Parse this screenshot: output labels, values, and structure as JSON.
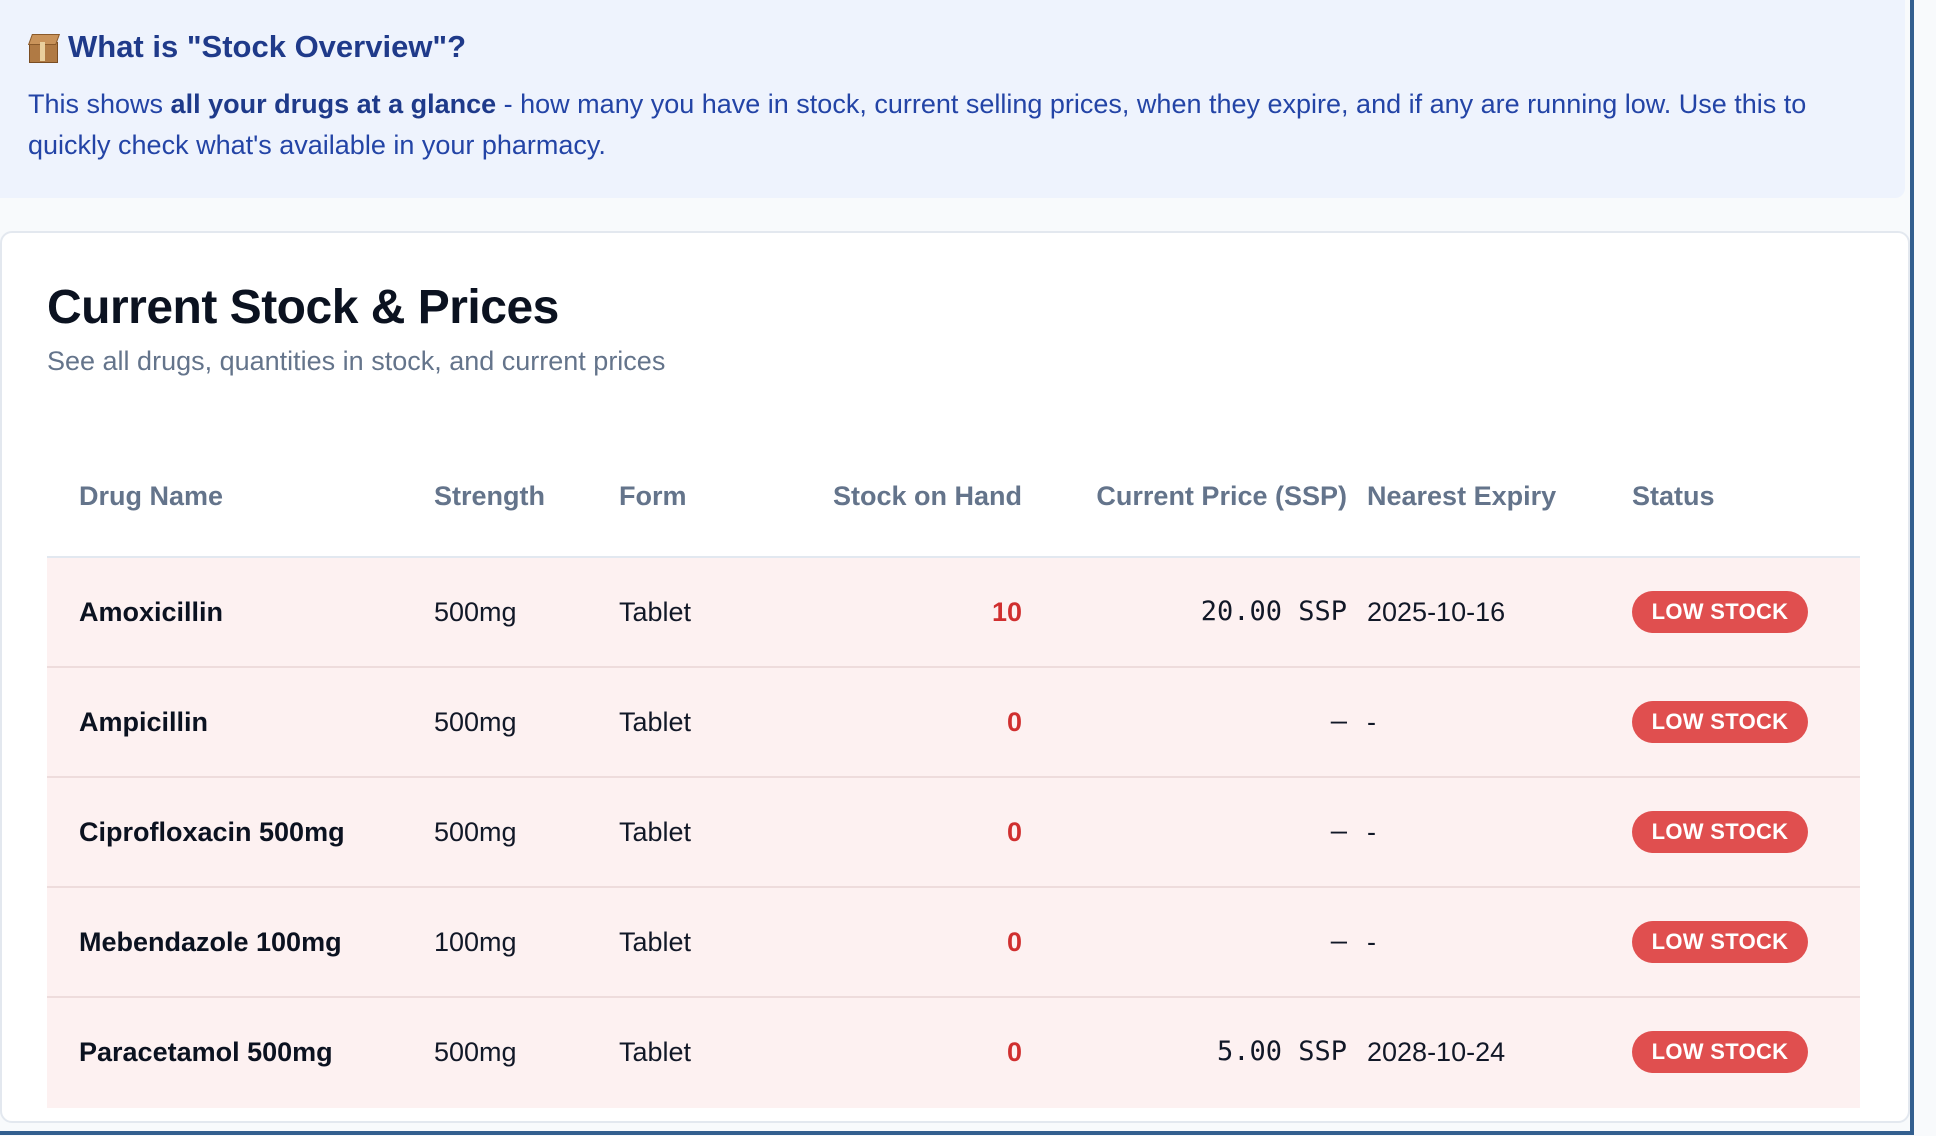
{
  "info": {
    "icon": "package-icon",
    "title": "What is \"Stock Overview\"?",
    "text_prefix": "This shows ",
    "text_bold": "all your drugs at a glance",
    "text_suffix": " - how many you have in stock, current selling prices, when they expire, and if any are running low. Use this to quickly check what's available in your pharmacy."
  },
  "card": {
    "title": "Current Stock & Prices",
    "subtitle": "See all drugs, quantities in stock, and current prices"
  },
  "table": {
    "columns": [
      "Drug Name",
      "Strength",
      "Form",
      "Stock on Hand",
      "Current Price (SSP)",
      "Nearest Expiry",
      "Status"
    ],
    "rows": [
      {
        "name": "Amoxicillin",
        "strength": "500mg",
        "form": "Tablet",
        "stock": "10",
        "price": "20.00 SSP",
        "expiry": "2025-10-16",
        "status": "LOW STOCK"
      },
      {
        "name": "Ampicillin",
        "strength": "500mg",
        "form": "Tablet",
        "stock": "0",
        "price": "—",
        "expiry": "-",
        "status": "LOW STOCK"
      },
      {
        "name": "Ciprofloxacin 500mg",
        "strength": "500mg",
        "form": "Tablet",
        "stock": "0",
        "price": "—",
        "expiry": "-",
        "status": "LOW STOCK"
      },
      {
        "name": "Mebendazole 100mg",
        "strength": "100mg",
        "form": "Tablet",
        "stock": "0",
        "price": "—",
        "expiry": "-",
        "status": "LOW STOCK"
      },
      {
        "name": "Paracetamol 500mg",
        "strength": "500mg",
        "form": "Tablet",
        "stock": "0",
        "price": "5.00 SSP",
        "expiry": "2028-10-24",
        "status": "LOW STOCK"
      }
    ]
  },
  "colors": {
    "info_background": "#eef3fd",
    "info_text": "#2344a6",
    "low_stock_badge": "#e04f4f",
    "low_stock_row": "#fdf1f1",
    "stock_low_text": "#d02f2f"
  }
}
